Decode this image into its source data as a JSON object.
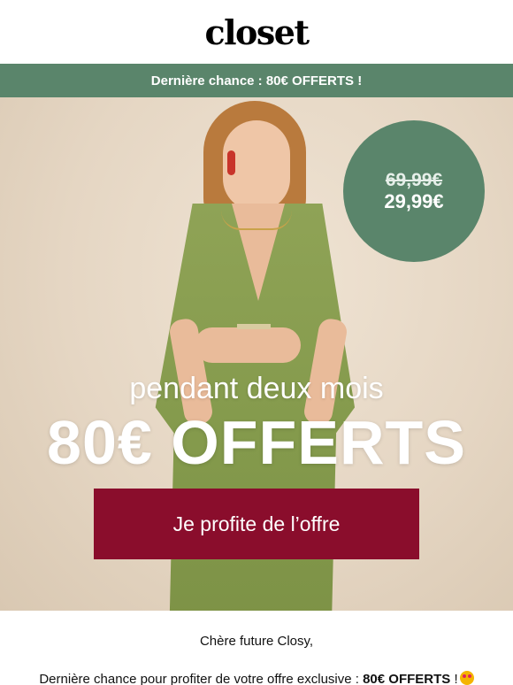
{
  "brand": {
    "logo_text": "closet"
  },
  "banner": {
    "text": "Dernière chance : 80€ OFFERTS !"
  },
  "hero": {
    "price_old": "69,99€",
    "price_new": "29,99€",
    "tagline": "pendant deux mois",
    "headline": "80€ OFFERTS",
    "cta_label": "Je profite de l’offre"
  },
  "message": {
    "greeting": "Chère future Closy,",
    "line_prefix": "Dernière chance pour profiter de votre offre exclusive : ",
    "line_bold": "80€ OFFERTS",
    "line_suffix": " !"
  },
  "colors": {
    "banner_green": "#5a856b",
    "cta_burgundy": "#8a0d2c",
    "dress_green": "#8fa356"
  },
  "icons": {
    "emoji": "heart-eyes-emoji-icon"
  }
}
